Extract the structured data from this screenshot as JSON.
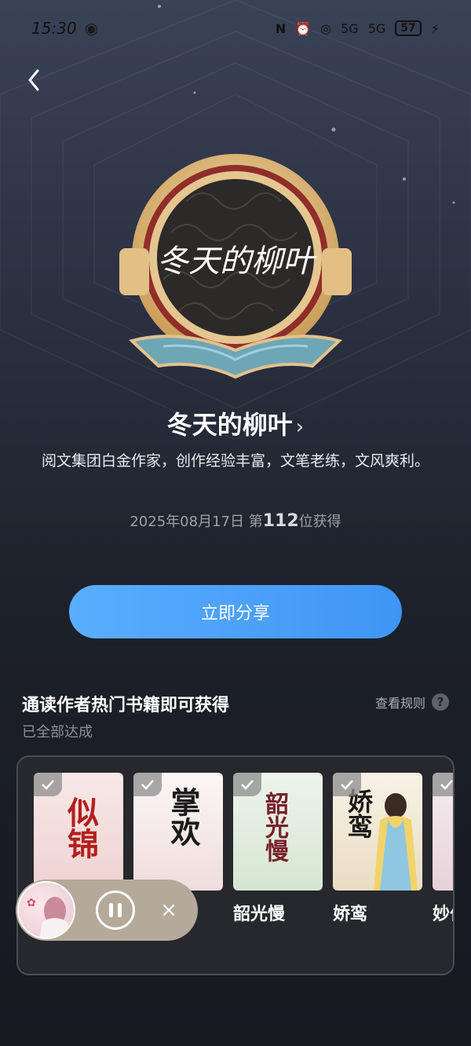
{
  "status_bar": {
    "time": "15:30",
    "battery": "57",
    "network": "5G"
  },
  "author": {
    "badge_signature": "冬天的柳叶",
    "name": "冬天的柳叶",
    "description": "阅文集团白金作家，创作经验丰富，文笔老练，文风爽利。",
    "date_prefix": "2025年08月17日 第",
    "rank": "112",
    "date_suffix": "位获得"
  },
  "share_button": "立即分享",
  "section": {
    "title": "通读作者热门书籍即可获得",
    "subtitle": "已全部达成",
    "rules_link": "查看规则",
    "rules_icon": "?"
  },
  "books": [
    {
      "title": "",
      "cover_text": "似锦",
      "cover_color": "#f3e2e0"
    },
    {
      "title": "",
      "cover_text": "掌欢",
      "cover_color": "#f6eeee"
    },
    {
      "title": "韶光慢",
      "cover_text": "韶光慢",
      "cover_color": "#e4efe2"
    },
    {
      "title": "娇鸾",
      "cover_text": "娇鸾",
      "cover_color": "#f5efe2"
    },
    {
      "title": "妙伯",
      "cover_text": "",
      "cover_color": "#f2e6ea"
    }
  ],
  "player": {
    "state": "playing",
    "close_icon": "×"
  }
}
